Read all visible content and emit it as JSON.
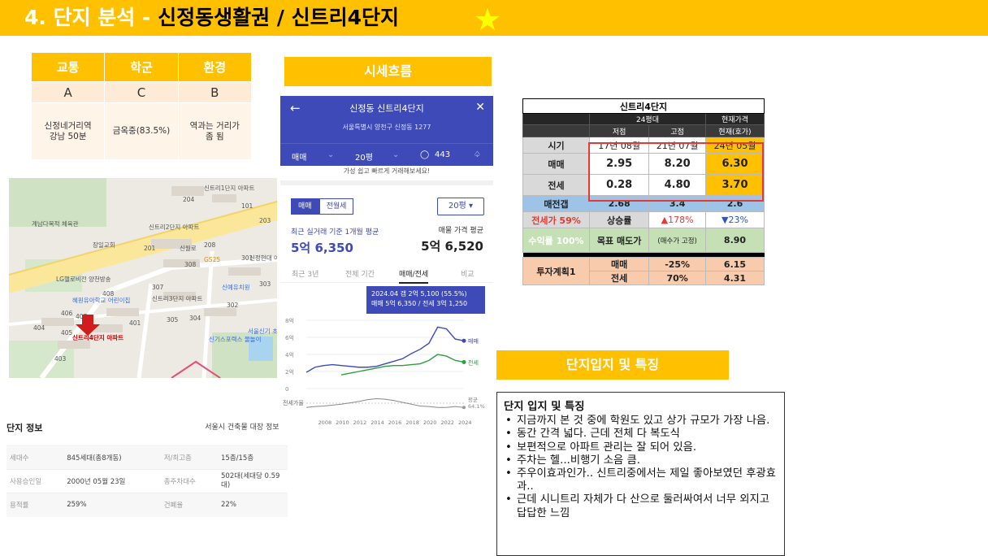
{
  "header": {
    "title_prefix": "4. 단지 분석 - ",
    "title_main": "신정동생활권 / 신트리4단지"
  },
  "grade_table": {
    "headers": [
      "교통",
      "학군",
      "환경"
    ],
    "grades": [
      "A",
      "C",
      "B"
    ],
    "details": [
      "신정네거리역\n강남 50분",
      "금옥중(83.5%)",
      "역과는 거리가\n좀 됨"
    ]
  },
  "sections": {
    "sise_label": "시세흐름",
    "ipji_label": "단지입지 및 특징"
  },
  "map": {
    "labels": {
      "complex1": "신트리1단지\n아파트",
      "gym": "계남다목적\n체육관",
      "complex2": "신트리2단지\n아파트",
      "church": "장일교회",
      "gs25": "GS25",
      "hyundai": "신정현대\n아파트",
      "bldg": "LG헬로비전\n양천방송",
      "kinder": "신예유치원",
      "daycare": "혜원유아학교\n어린이집",
      "complex3": "신트리3단지\n아파트",
      "complex4": "신트리4단지\n아파트",
      "school": "서울신기\n초등학교",
      "sports": "신기스포렉스\n물놀이",
      "road": "신월로"
    },
    "numbers": [
      "204",
      "101",
      "203",
      "201",
      "208",
      "301",
      "308",
      "305",
      "307",
      "406",
      "407",
      "408",
      "404",
      "405",
      "403",
      "401",
      "302",
      "303",
      "304"
    ]
  },
  "complex_info": {
    "title": "단지 정보",
    "link": "서울시 건축물 대장 정보 >",
    "rows": [
      {
        "k1": "세대수",
        "v1": "845세대(총8개동)",
        "k2": "저/최고층",
        "v2": "15층/15층"
      },
      {
        "k1": "사용승인일",
        "v1": "2000년 05월 23일",
        "k2": "총주차대수",
        "v2": "502대(세대당 0.59대)"
      },
      {
        "k1": "용적률",
        "v1": "259%",
        "k2": "건폐율",
        "v2": "22%"
      }
    ]
  },
  "phone": {
    "title": "신정동 신트리4단지",
    "address": "서울특별시 양천구 신정동 1277",
    "tabs": {
      "deal": "매매",
      "size": "20평",
      "count": "443"
    },
    "banner": "가성 쉽고 빠르게 거래해보세요!",
    "segments": [
      "매매",
      "전월세"
    ],
    "size_select": "20평",
    "recent_label": "최근 실거래 기준 1개월 평균",
    "recent_value": "5억 6,350",
    "ask_label": "매물 가격 평균",
    "ask_value": "5억 6,520",
    "periods": [
      "최근 3년",
      "전체 기간",
      "매매/전세",
      "비교"
    ],
    "tooltip_line1": "2024.04  갭 2억 5,100 (55.5%)",
    "tooltip_line2": "매매 5억 6,350 / 전세 3억 1,250"
  },
  "chart_data": {
    "type": "line",
    "x": [
      2006,
      2007,
      2008,
      2009,
      2010,
      2011,
      2012,
      2013,
      2014,
      2015,
      2016,
      2017,
      2018,
      2019,
      2020,
      2021,
      2022,
      2023,
      2024
    ],
    "xticks": [
      "2008",
      "2010",
      "2012",
      "2014",
      "2016",
      "2018",
      "2020",
      "2022",
      "2024"
    ],
    "yticks": [
      "8억",
      "6억",
      "4억",
      "2억",
      "0"
    ],
    "ylim": [
      0,
      8
    ],
    "series": [
      {
        "name": "매매",
        "color": "#3d4ab8",
        "values": [
          1.9,
          2.5,
          2.7,
          2.8,
          2.7,
          2.6,
          2.5,
          2.5,
          2.6,
          2.9,
          3.2,
          3.5,
          4.1,
          4.6,
          5.3,
          7.2,
          7.0,
          5.8,
          5.6
        ]
      },
      {
        "name": "전세",
        "color": "#2e9d3e",
        "values": [
          null,
          null,
          null,
          null,
          1.6,
          1.8,
          2.0,
          2.2,
          2.4,
          2.6,
          2.7,
          2.7,
          2.8,
          2.9,
          3.3,
          4.0,
          3.8,
          3.3,
          3.1
        ]
      }
    ],
    "ratio_label": "전세가율",
    "ratio_end_label": "평균\n64.1%",
    "ratio_values": [
      55,
      57,
      58,
      60,
      62,
      65,
      68,
      72,
      74,
      73,
      70,
      66,
      62,
      58,
      57,
      55,
      55,
      57,
      55
    ]
  },
  "price_table": {
    "title": "신트리4단지",
    "size": "24평대",
    "current": "현재가격",
    "low": "저점",
    "high": "고점",
    "now": "현재(호가)",
    "row_period": {
      "label": "시기",
      "low": "17년 08월",
      "high": "21년 07월",
      "now": "24년 05월"
    },
    "row_deal": {
      "label": "매매",
      "low": "2.95",
      "high": "8.20",
      "now": "6.30"
    },
    "row_jeonse": {
      "label": "전세",
      "low": "0.28",
      "high": "4.80",
      "now": "3.70"
    },
    "row_gap": {
      "label": "매전갭",
      "low": "2.68",
      "high": "3.4",
      "now": "2.6"
    },
    "row_rate": {
      "label": "전세가 59%",
      "mid_label": "상승률",
      "high": "▲178%",
      "now": "▼23%"
    },
    "row_target": {
      "label": "수익률 100%",
      "mid_label": "목표 매도가",
      "note": "(매수가 고정)",
      "now": "8.90"
    },
    "plan": {
      "label": "투자계획1",
      "deal": "매매",
      "deal_pct": "-25%",
      "deal_val": "6.15",
      "jeonse": "전세",
      "jeonse_pct": "70%",
      "jeonse_val": "4.31"
    }
  },
  "notes": {
    "title": "단지 입지 및 특징",
    "items": [
      "지금까지 본 것 중에 학원도 있고 상가 규모가 가장 나음.",
      "동간 간격 넓다. 근데 전체 다 복도식",
      "보편적으로 아파트 관리는 잘 되어 있음.",
      "주차는 헬...비행기 소음 큼.",
      "주우이효과인가.. 신트리중에서는 제일 좋아보였던 후광효과..",
      "근데 시니트리 자체가 다 산으로 둘러싸여서 너무 외지고 답답한 느낌"
    ]
  }
}
